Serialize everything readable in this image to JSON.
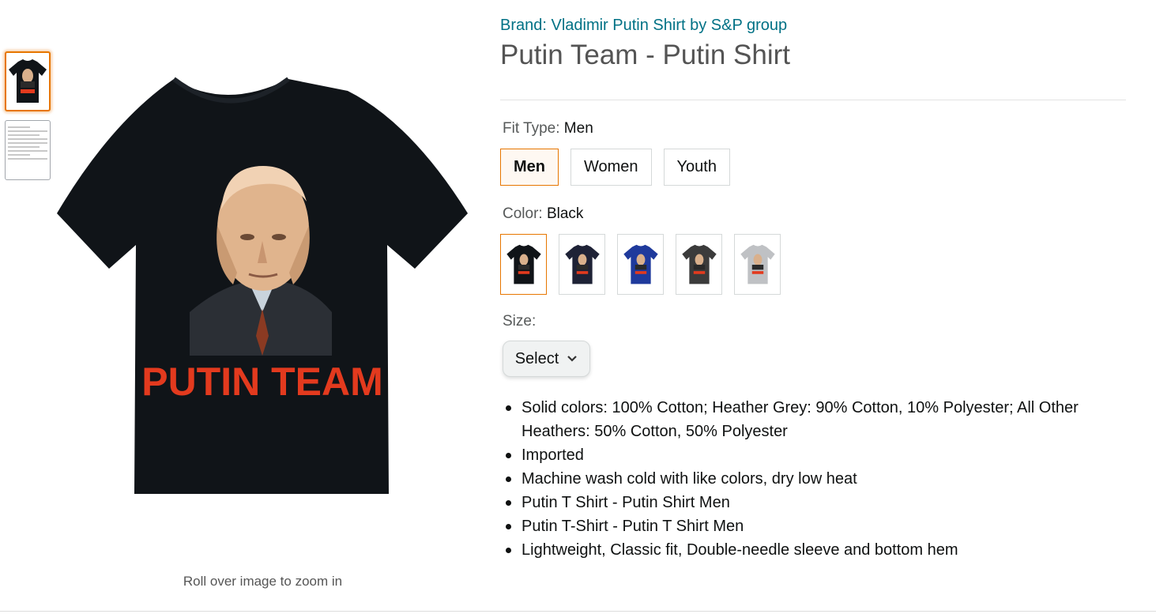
{
  "brand_link": "Brand: Vladimir Putin Shirt by S&P group",
  "product_title": "Putin Team - Putin Shirt",
  "shirt_print_text": "PUTIN TEAM",
  "zoom_hint": "Roll over image to zoom in",
  "fit_type": {
    "label": "Fit Type: ",
    "selected": "Men",
    "options": [
      "Men",
      "Women",
      "Youth"
    ]
  },
  "color": {
    "label": "Color: ",
    "selected": "Black",
    "swatch_colors": [
      "#101418",
      "#1e2236",
      "#1f3a9c",
      "#3b3b3b",
      "#bfc1c4"
    ]
  },
  "size": {
    "label": "Size:",
    "select_value": "Select"
  },
  "bullets": [
    "Solid colors: 100% Cotton; Heather Grey: 90% Cotton, 10% Polyester; All Other Heathers: 50% Cotton, 50% Polyester",
    "Imported",
    "Machine wash cold with like colors, dry low heat",
    "Putin T Shirt - Putin Shirt Men",
    "Putin T-Shirt - Putin T Shirt Men",
    "Lightweight, Classic fit, Double-needle sleeve and bottom hem"
  ],
  "colors": {
    "link": "#007185",
    "selected_border": "#e77600",
    "print_red": "#e33a1e",
    "shirt_black": "#101418"
  },
  "icons": {
    "select_chevron": "chevron-down-icon"
  }
}
